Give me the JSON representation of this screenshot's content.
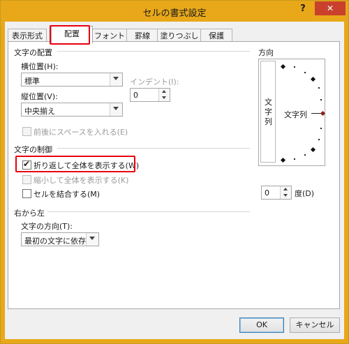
{
  "window": {
    "title": "セルの書式設定",
    "help_glyph": "?",
    "close_glyph": "✕"
  },
  "tabs": [
    {
      "label": "表示形式"
    },
    {
      "label": "配置"
    },
    {
      "label": "フォント"
    },
    {
      "label": "罫線"
    },
    {
      "label": "塗りつぶし"
    },
    {
      "label": "保護"
    }
  ],
  "text_alignment": {
    "heading": "文字の配置",
    "horizontal_label": "横位置(H):",
    "horizontal_value": "標準",
    "indent_label": "インデント(I):",
    "indent_value": "0",
    "vertical_label": "縦位置(V):",
    "vertical_value": "中央揃え",
    "distributed_label": "前後にスペースを入れる(E)"
  },
  "text_control": {
    "heading": "文字の制御",
    "wrap_label": "折り返して全体を表示する(W)",
    "wrap_checked": true,
    "shrink_label": "縮小して全体を表示する(K)",
    "shrink_checked": false,
    "merge_label": "セルを結合する(M)",
    "merge_checked": false
  },
  "rtl": {
    "heading": "右から左",
    "direction_label": "文字の方向(T):",
    "direction_value": "最初の文字に依存"
  },
  "orientation": {
    "heading": "方向",
    "vertical_chars": [
      "文",
      "字",
      "列"
    ],
    "horizontal_text": "文字列",
    "degree_value": "0",
    "degree_label": "度(D)"
  },
  "buttons": {
    "ok": "OK",
    "cancel": "キャンセル"
  },
  "colors": {
    "title_bar": "#e8a81a",
    "close": "#c9402c",
    "highlight": "#e8000e"
  }
}
